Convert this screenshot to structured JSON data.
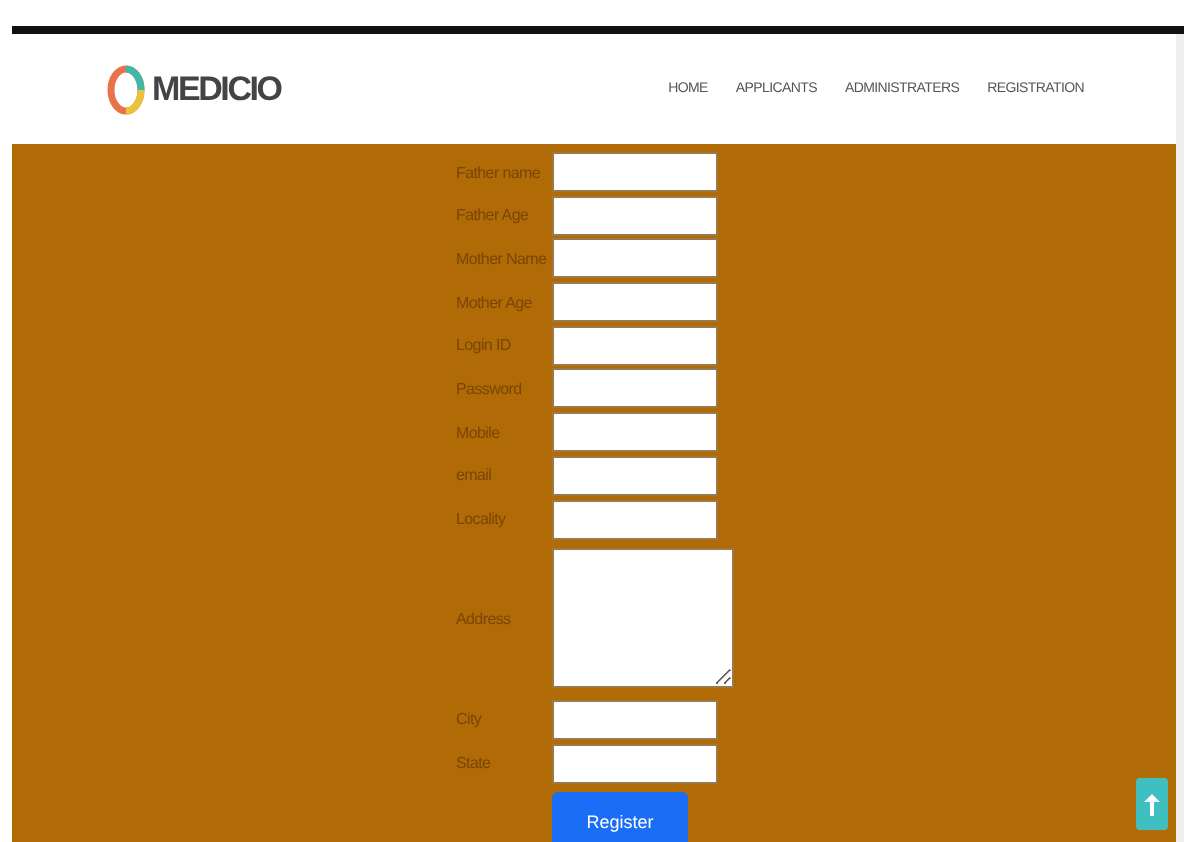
{
  "header": {
    "logo": "MEDICIO",
    "nav": [
      "HOME",
      "APPLICANTS",
      "ADMINISTRATERS",
      "REGISTRATION"
    ]
  },
  "form": {
    "fields": [
      {
        "label": "Father name",
        "kind": "text"
      },
      {
        "label": "Father Age",
        "kind": "text"
      },
      {
        "label": "Mother Name",
        "kind": "text"
      },
      {
        "label": "Mother Age",
        "kind": "text"
      },
      {
        "label": "Login ID",
        "kind": "text"
      },
      {
        "label": "Password",
        "kind": "text"
      },
      {
        "label": "Mobile",
        "kind": "text"
      },
      {
        "label": "email",
        "kind": "text"
      },
      {
        "label": "Locality",
        "kind": "text"
      },
      {
        "label": "Address",
        "kind": "textarea"
      },
      {
        "label": "City",
        "kind": "text"
      },
      {
        "label": "State",
        "kind": "text"
      }
    ],
    "submit": "Register"
  }
}
